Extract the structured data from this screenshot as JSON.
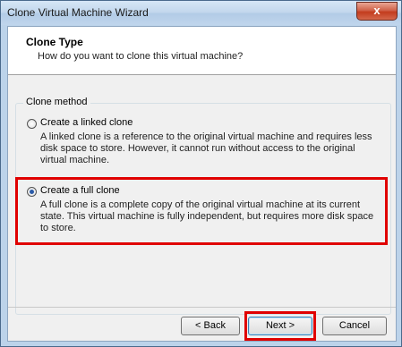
{
  "window": {
    "title": "Clone Virtual Machine Wizard",
    "close_label": "x"
  },
  "header": {
    "title": "Clone Type",
    "subtitle": "How do you want to clone this virtual machine?"
  },
  "group": {
    "legend": "Clone method",
    "options": [
      {
        "label": "Create a linked clone",
        "checked": false,
        "description": "A linked clone is a reference to the original virtual machine and requires less disk space to store. However, it cannot run without access to the original virtual machine."
      },
      {
        "label": "Create a full clone",
        "checked": true,
        "description": "A full clone is a complete copy of the original virtual machine at its current state. This virtual machine is fully independent, but requires more disk space to store."
      }
    ]
  },
  "buttons": {
    "back": "< Back",
    "next": "Next >",
    "cancel": "Cancel"
  },
  "colors": {
    "highlight": "#e00000",
    "titlebar": "#bfd5ec",
    "close": "#c33c1d"
  }
}
